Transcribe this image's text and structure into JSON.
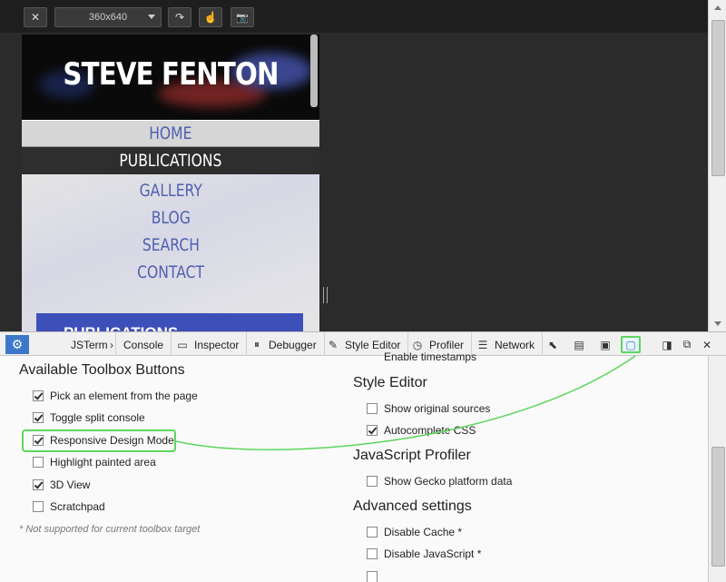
{
  "rdm_toolbar": {
    "close_glyph": "✕",
    "preset_value": "360x640",
    "rotate_glyph": "↷",
    "touch_glyph": "☝",
    "screenshot_glyph": "📷"
  },
  "site": {
    "title": "STEVE FENTON",
    "nav": [
      "HOME",
      "PUBLICATIONS",
      "GALLERY",
      "BLOG",
      "SEARCH",
      "CONTACT"
    ],
    "active_nav": "PUBLICATIONS",
    "section_heading": "PUBLICATIONS"
  },
  "devtools": {
    "tabs": [
      {
        "label": "JSTerm",
        "icon": "jsterm-icon"
      },
      {
        "label": "Console",
        "icon": "console-icon"
      },
      {
        "label": "Inspector",
        "icon": "inspector-icon"
      },
      {
        "label": "Debugger",
        "icon": "debugger-icon"
      },
      {
        "label": "Style Editor",
        "icon": "style-editor-icon"
      },
      {
        "label": "Profiler",
        "icon": "profiler-icon"
      },
      {
        "label": "Network",
        "icon": "network-icon"
      }
    ],
    "tools": [
      "pick-element-icon",
      "split-console-icon",
      "3d-view-icon",
      "responsive-design-icon"
    ],
    "window_controls": [
      "dock-side-icon",
      "undock-icon",
      "close-icon"
    ]
  },
  "options": {
    "toolbox_heading": "Available Toolbox Buttons",
    "toolbox_buttons": [
      {
        "label": "Pick an element from the page",
        "checked": true
      },
      {
        "label": "Toggle split console",
        "checked": true
      },
      {
        "label": "Responsive Design Mode",
        "checked": true
      },
      {
        "label": "Highlight painted area",
        "checked": false
      },
      {
        "label": "3D View",
        "checked": true
      },
      {
        "label": "Scratchpad",
        "checked": false
      }
    ],
    "not_supported_note": "* Not supported for current toolbox target",
    "enable_timestamps": "Enable timestamps",
    "style_editor_heading": "Style Editor",
    "style_editor_opts": [
      {
        "label": "Show original sources",
        "checked": false
      },
      {
        "label": "Autocomplete CSS",
        "checked": true
      }
    ],
    "profiler_heading": "JavaScript Profiler",
    "profiler_opts": [
      {
        "label": "Show Gecko platform data",
        "checked": false
      }
    ],
    "advanced_heading": "Advanced settings",
    "advanced_opts": [
      {
        "label": "Disable Cache *",
        "checked": false
      },
      {
        "label": "Disable JavaScript *",
        "checked": false
      }
    ]
  },
  "colors": {
    "highlight": "#5cd65c",
    "accent_blue": "#3c78c8",
    "nav_text": "#4f5fb0"
  }
}
